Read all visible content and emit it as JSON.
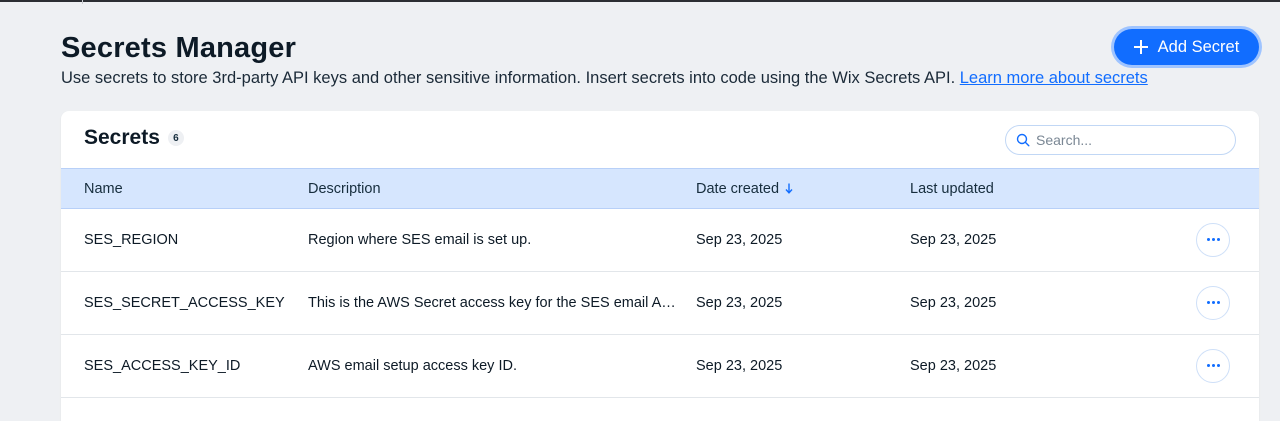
{
  "page": {
    "title": "Secrets Manager",
    "subtitle": "Use secrets to store 3rd-party API keys and other sensitive information. Insert secrets into code using the Wix Secrets API.",
    "learn_more_link": "Learn more about secrets",
    "add_button_label": "Add Secret"
  },
  "card": {
    "title": "Secrets",
    "count": "6",
    "search_placeholder": "Search..."
  },
  "table": {
    "columns": {
      "name": "Name",
      "description": "Description",
      "date_created": "Date created",
      "last_updated": "Last updated"
    },
    "rows": [
      {
        "name": "SES_REGION",
        "description": "Region where SES email is set up.",
        "date_created": "Sep 23, 2025",
        "last_updated": "Sep 23, 2025"
      },
      {
        "name": "SES_SECRET_ACCESS_KEY",
        "description": "This is the AWS Secret access key for the SES email API, used to send emails.",
        "date_created": "Sep 23, 2025",
        "last_updated": "Sep 23, 2025"
      },
      {
        "name": "SES_ACCESS_KEY_ID",
        "description": "AWS email setup access key ID.",
        "date_created": "Sep 23, 2025",
        "last_updated": "Sep 23, 2025"
      }
    ]
  },
  "colors": {
    "accent": "#116dff",
    "page_background": "#eef0f3",
    "table_header_background": "#d6e6fe"
  },
  "icons": {
    "add": "plus-icon",
    "search": "search-icon",
    "sort": "arrow-down-icon",
    "row_actions": "more-horizontal-icon"
  }
}
